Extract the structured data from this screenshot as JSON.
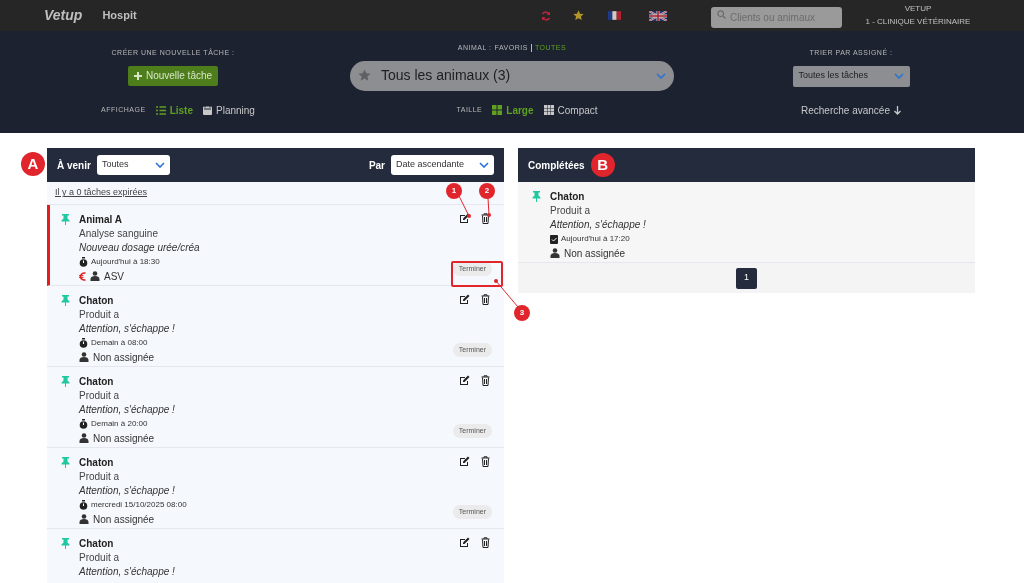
{
  "header": {
    "logo": "Vetup",
    "app": "Hospit",
    "search_placeholder": "Clients ou animaux",
    "account_name": "VETUP",
    "clinic": "1 - CLINIQUE VÉTÉRINAIRE"
  },
  "toolbar": {
    "create_label": "CRÉER UNE NOUVELLE TÂCHE :",
    "new_task_button": "Nouvelle tâche",
    "animal_label": "ANIMAL :",
    "animal_filters": [
      {
        "label": "FAVORIS",
        "selected": false
      },
      {
        "label": "TOUTES",
        "selected": true
      }
    ],
    "animal_select": "Tous les animaux (3)",
    "sort_label": "TRIER PAR ASSIGNÉ :",
    "sort_select": "Toutes les tâches",
    "display_label": "AFFICHAGE",
    "display_options": [
      {
        "kind": "list",
        "label": "Liste",
        "selected": true
      },
      {
        "kind": "calendar",
        "label": "Planning",
        "selected": false
      }
    ],
    "size_label": "TAILLE",
    "size_options": [
      {
        "kind": "large",
        "label": "Large",
        "selected": true
      },
      {
        "kind": "compact",
        "label": "Compact",
        "selected": false
      }
    ],
    "advanced_search": "Recherche avancée"
  },
  "upcoming": {
    "title": "À venir",
    "filter": "Toutes",
    "sort_label": "Par",
    "sort": "Date ascendante",
    "expired_link": "Il y a 0 tâches expirées",
    "tasks": [
      {
        "animal": "Animal A",
        "task": "Analyse sanguine",
        "note": "Nouveau dosage urée/créa",
        "due": "Aujourd'hui à 18:30",
        "assignee": "ASV",
        "billable": true,
        "urgent": true,
        "action": "Terminer"
      },
      {
        "animal": "Chaton",
        "task": "Produit a",
        "note": "Attention, s'échappe !",
        "due": "Demain à 08:00",
        "assignee": "Non assignée",
        "billable": false,
        "urgent": false,
        "action": "Terminer"
      },
      {
        "animal": "Chaton",
        "task": "Produit a",
        "note": "Attention, s'échappe !",
        "due": "Demain à 20:00",
        "assignee": "Non assignée",
        "billable": false,
        "urgent": false,
        "action": "Terminer"
      },
      {
        "animal": "Chaton",
        "task": "Produit a",
        "note": "Attention, s'échappe !",
        "due": "mercredi 15/10/2025 08:00",
        "assignee": "Non assignée",
        "billable": false,
        "urgent": false,
        "action": "Terminer"
      },
      {
        "animal": "Chaton",
        "task": "Produit a",
        "note": "Attention, s'échappe !",
        "urgent": false
      }
    ]
  },
  "completed": {
    "title": "Complétées",
    "tasks": [
      {
        "animal": "Chaton",
        "task": "Produit a",
        "note": "Attention, s'échappe !",
        "done": "Aujourd'hui à 17:20",
        "assignee": "Non assignée"
      }
    ],
    "pages": [
      {
        "label": "1",
        "selected": true
      }
    ]
  },
  "annotations": [
    {
      "label": "A"
    },
    {
      "label": "B"
    },
    {
      "label": "1"
    },
    {
      "label": "2"
    },
    {
      "label": "3"
    }
  ]
}
